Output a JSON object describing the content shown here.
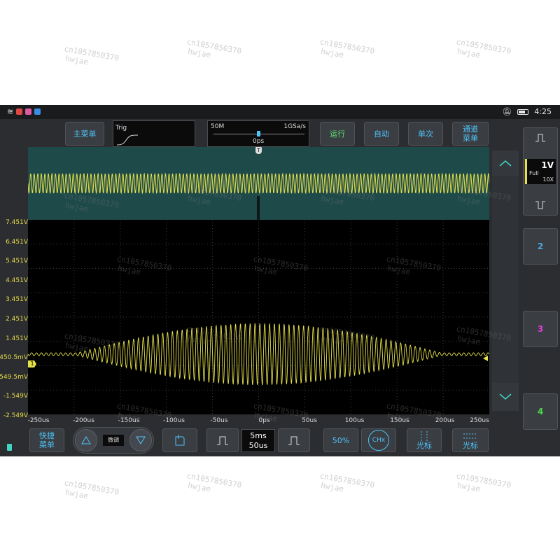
{
  "status": {
    "time": "4:25"
  },
  "top": {
    "main_menu": "主菜单",
    "trig_label": "Trig",
    "sample_depth": "50M",
    "sample_rate": "1GSa/s",
    "time_offset": "0ps",
    "run": "运行",
    "auto": "自动",
    "single": "单次",
    "channel_menu": "通道\n菜单"
  },
  "channel_panel": {
    "volts": "1V",
    "coupling": "Full",
    "probe": "10X",
    "ch2": "2",
    "ch3": "3",
    "ch4": "4"
  },
  "y_axis": [
    "7.451V",
    "6.451V",
    "5.451V",
    "4.451V",
    "3.451V",
    "2.451V",
    "1.451V",
    "450.5mV",
    "-549.5mV",
    "-1.549V",
    "-2.549V"
  ],
  "x_axis": [
    "-250us",
    "-200us",
    "-150us",
    "-100us",
    "-50us",
    "0ps",
    "50us",
    "100us",
    "150us",
    "200us",
    "250us"
  ],
  "bottom": {
    "quick_menu": "快捷\n菜单",
    "fine": "微调",
    "timebase_main": "5ms",
    "timebase_sub": "50us",
    "trig_level": "50%",
    "cursor1": "光标",
    "cursor2": "光标",
    "ch_key": "CHx"
  },
  "colors": {
    "ch1": "#e6e24a",
    "accent": "#4fc3f7",
    "green": "#5ddb6f",
    "ch3": "#d63fd6",
    "ch4": "#4ad64a",
    "ch2": "#4fa7e0"
  },
  "watermark": {
    "line1": "cn1057850370",
    "line2": "hwjae"
  }
}
